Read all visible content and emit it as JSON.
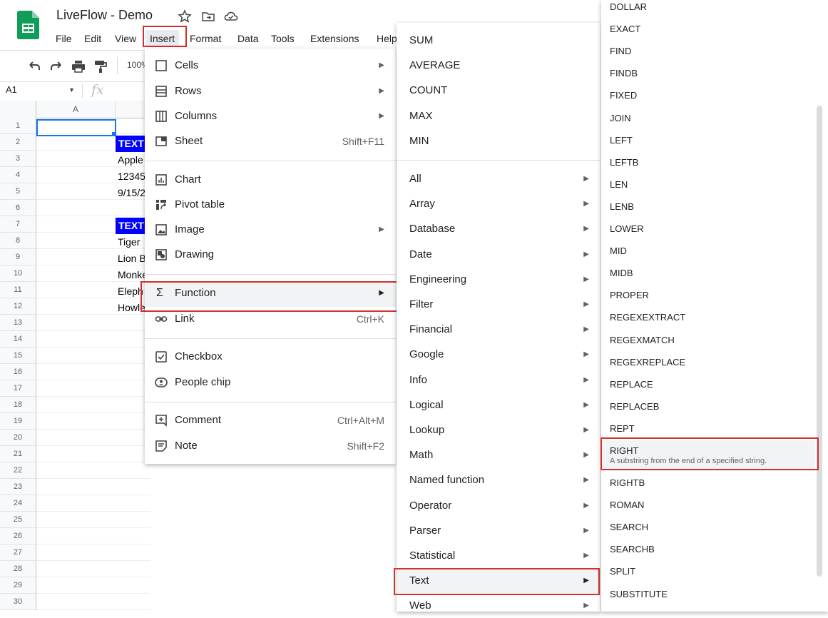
{
  "app": {
    "doc_title": "LiveFlow - Demo",
    "menubar": [
      "File",
      "Edit",
      "View",
      "Insert",
      "Format",
      "Data",
      "Tools",
      "Extensions",
      "Help"
    ]
  },
  "toolbar": {
    "zoom": "100%"
  },
  "formula_bar": {
    "name_box": "A1",
    "fx": "fx"
  },
  "grid": {
    "column_header": "A",
    "rows": [
      "1",
      "2",
      "3",
      "4",
      "5",
      "6",
      "7",
      "8",
      "9",
      "10",
      "11",
      "12",
      "13",
      "14",
      "15",
      "16",
      "17",
      "18",
      "19",
      "20",
      "21",
      "22",
      "23",
      "24",
      "25",
      "26",
      "27",
      "28",
      "29",
      "30"
    ],
    "cells": [
      "TEXT",
      "Apple",
      "12345",
      "9/15/2",
      "TEXT",
      "Tiger",
      "Lion B",
      "Monke",
      "Eleph",
      "Howle"
    ]
  },
  "insert_menu": {
    "items": [
      {
        "label": "Cells",
        "shortcut": "",
        "submenu": true,
        "icon": "cells-icon"
      },
      {
        "label": "Rows",
        "shortcut": "",
        "submenu": true,
        "icon": "rows-icon"
      },
      {
        "label": "Columns",
        "shortcut": "",
        "submenu": true,
        "icon": "columns-icon"
      },
      {
        "label": "Sheet",
        "shortcut": "Shift+F11",
        "submenu": false,
        "icon": "sheet-icon"
      },
      {
        "label": "Chart",
        "shortcut": "",
        "submenu": false,
        "icon": "chart-icon"
      },
      {
        "label": "Pivot table",
        "shortcut": "",
        "submenu": false,
        "icon": "pivot-table-icon"
      },
      {
        "label": "Image",
        "shortcut": "",
        "submenu": true,
        "icon": "image-icon"
      },
      {
        "label": "Drawing",
        "shortcut": "",
        "submenu": false,
        "icon": "drawing-icon"
      },
      {
        "label": "Function",
        "shortcut": "",
        "submenu": true,
        "icon": "sigma-icon"
      },
      {
        "label": "Link",
        "shortcut": "Ctrl+K",
        "submenu": false,
        "icon": "link-icon"
      },
      {
        "label": "Checkbox",
        "shortcut": "",
        "submenu": false,
        "icon": "checkbox-icon"
      },
      {
        "label": "People chip",
        "shortcut": "",
        "submenu": false,
        "icon": "people-chip-icon"
      },
      {
        "label": "Comment",
        "shortcut": "Ctrl+Alt+M",
        "submenu": false,
        "icon": "comment-icon"
      },
      {
        "label": "Note",
        "shortcut": "Shift+F2",
        "submenu": false,
        "icon": "note-icon"
      }
    ]
  },
  "function_menu": {
    "quick": [
      "SUM",
      "AVERAGE",
      "COUNT",
      "MAX",
      "MIN"
    ],
    "categories": [
      "All",
      "Array",
      "Database",
      "Date",
      "Engineering",
      "Filter",
      "Financial",
      "Google",
      "Info",
      "Logical",
      "Lookup",
      "Math",
      "Named function",
      "Operator",
      "Parser",
      "Statistical",
      "Text",
      "Web"
    ]
  },
  "text_menu": {
    "items": [
      "DOLLAR",
      "EXACT",
      "FIND",
      "FINDB",
      "FIXED",
      "JOIN",
      "LEFT",
      "LEFTB",
      "LEN",
      "LENB",
      "LOWER",
      "MID",
      "MIDB",
      "PROPER",
      "REGEXEXTRACT",
      "REGEXMATCH",
      "REGEXREPLACE",
      "REPLACE",
      "REPLACEB",
      "REPT",
      "RIGHT",
      "RIGHTB",
      "ROMAN",
      "SEARCH",
      "SEARCHB",
      "SPLIT",
      "SUBSTITUTE"
    ],
    "right_description": "A substring from the end of a specified string."
  },
  "colors": {
    "highlight_border": "#d32f2f",
    "selection": "#1a73e8",
    "text_header_fill": "#0000ff",
    "sheets_green": "#0f9d58"
  }
}
